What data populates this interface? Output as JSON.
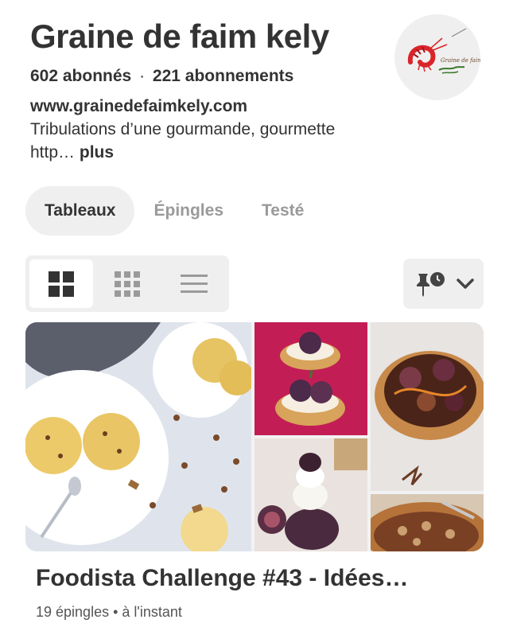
{
  "profile": {
    "name": "Graine de faim kely",
    "followers": "602 abonnés",
    "following": "221 abonnements",
    "separator": "·",
    "website": "www.grainedefaimkely.com",
    "bio": "Tribulations d’une gourmande, gourmette http…",
    "more_label": "plus",
    "avatar_text": "Graine de faim kely"
  },
  "tabs": [
    {
      "label": "Tableaux",
      "active": true
    },
    {
      "label": "Épingles",
      "active": false
    },
    {
      "label": "Testé",
      "active": false
    }
  ],
  "view_options": [
    {
      "icon": "large-grid-icon",
      "active": true
    },
    {
      "icon": "small-grid-icon",
      "active": false
    },
    {
      "icon": "list-icon",
      "active": false
    }
  ],
  "sort": {
    "icon": "pin-clock-icon",
    "dropdown_icon": "chevron-down-icon"
  },
  "board": {
    "title": "Foodista Challenge #43 - Idées…",
    "pin_count": "19 épingles",
    "meta_separator": "•",
    "updated": "à l'instant"
  },
  "colors": {
    "text_primary": "#333333",
    "text_muted": "#9a9a9a",
    "control_bg": "#efefef",
    "fig_pink_bg": "#c21e55",
    "avatar_red": "#d9252a"
  }
}
